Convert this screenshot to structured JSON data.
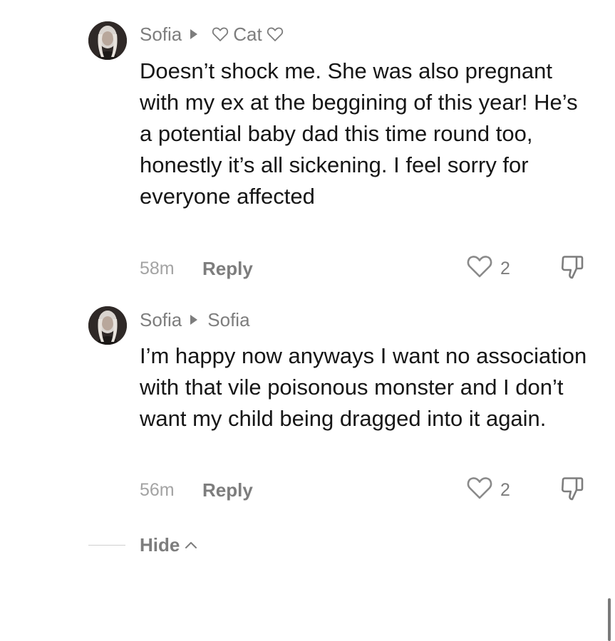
{
  "comments": [
    {
      "author": "Sofia",
      "reply_to": "Cat",
      "reply_to_has_hearts": true,
      "text": "Doesn’t shock me. She was also pregnant with my ex at the beggining of this year! He’s a potential baby dad this time round too, honestly it’s all sickening. I feel sorry for everyone affected",
      "time": "58m",
      "reply_label": "Reply",
      "likes": "2"
    },
    {
      "author": "Sofia",
      "reply_to": "Sofia",
      "reply_to_has_hearts": false,
      "text": "I’m happy now anyways I want no association with that vile poisonous monster and I don’t want my child being dragged into it again.",
      "time": "56m",
      "reply_label": "Reply",
      "likes": "2"
    }
  ],
  "hide_label": "Hide",
  "icons": {
    "like": "heart-outline-icon",
    "dislike": "thumbs-down-icon",
    "reply_arrow": "triangle-right-icon",
    "collapse": "chevron-up-icon"
  },
  "colors": {
    "text": "#161616",
    "secondary": "#7d7d7d",
    "muted": "#a3a3a3",
    "background": "#ffffff"
  }
}
